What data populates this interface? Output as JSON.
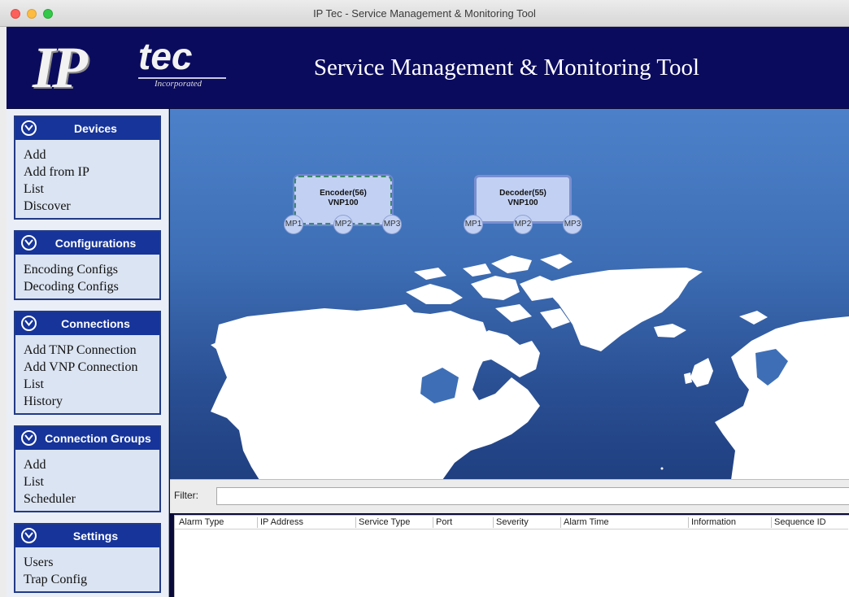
{
  "window": {
    "title": "IP Tec - Service Management & Monitoring Tool"
  },
  "header": {
    "logo_ip": "IP",
    "logo_tec": "tec",
    "logo_sub": "Incorporated",
    "title": "Service Management & Monitoring Tool"
  },
  "sidebar": {
    "panels": [
      {
        "title": "Devices",
        "items": [
          "Add",
          "Add from IP",
          "List",
          "Discover"
        ]
      },
      {
        "title": "Configurations",
        "items": [
          "Encoding Configs",
          "Decoding Configs"
        ]
      },
      {
        "title": "Connections",
        "items": [
          "Add TNP Connection",
          "Add VNP Connection",
          "List",
          "History"
        ]
      },
      {
        "title": "Connection Groups",
        "items": [
          "Add",
          "List",
          "Scheduler"
        ]
      },
      {
        "title": "Settings",
        "items": [
          "Users",
          "Trap Config"
        ]
      }
    ]
  },
  "map": {
    "devices": [
      {
        "name": "Encoder(56)",
        "model": "VNP100",
        "ports": [
          "MP1",
          "MP2",
          "MP3"
        ]
      },
      {
        "name": "Decoder(55)",
        "model": "VNP100",
        "ports": [
          "MP1",
          "MP2",
          "MP3"
        ]
      }
    ]
  },
  "filter": {
    "label": "Filter:",
    "value": ""
  },
  "alarms": {
    "columns": [
      "Alarm Type",
      "IP Address",
      "Service Type",
      "Port",
      "Severity",
      "Alarm Time",
      "Information",
      "Sequence ID"
    ],
    "rows": []
  },
  "colors": {
    "banner": "#0b0b5e",
    "panel_header": "#16349a",
    "map_ocean": "#3e6fb6",
    "device_fill": "#c2d1f3"
  }
}
